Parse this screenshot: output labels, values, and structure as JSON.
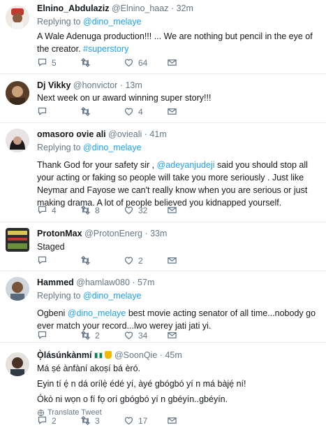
{
  "tweets": [
    {
      "name": "Elnino_Abdulaziz",
      "handle": "@Elnino_haaz",
      "sep": "·",
      "time": "32m",
      "replying_prefix": "Replying to ",
      "replying_to": "@dino_melaye",
      "text_parts": [
        "A Wale Adenuga production!!! ... We are nothing but pencil in the eye of the creator. ",
        "#superstory"
      ],
      "reply_count": "5",
      "retweet_count": "",
      "like_count": "64"
    },
    {
      "name": "Dj Vikky",
      "handle": "@honvictor",
      "sep": "·",
      "time": "13m",
      "text": "Next week on ur award winning super story!!!",
      "reply_count": "",
      "retweet_count": "",
      "like_count": "4"
    },
    {
      "name": "omasoro ovie ali",
      "handle": "@ovieali",
      "sep": "·",
      "time": "41m",
      "replying_prefix": "Replying to ",
      "replying_to": "@dino_melaye",
      "text_parts": [
        "Thank God for your safety sir , ",
        "@adeyanjudeji",
        " said you should stop all your acting or faking so people will take you more seriously . Just like Neymar and Fayose we can't really know when you are serious or just making drama. A lot of people believed you kidnapped yourself."
      ],
      "reply_count": "4",
      "retweet_count": "8",
      "like_count": "32"
    },
    {
      "name": "ProtonMax",
      "handle": "@ProtonEnerg",
      "sep": "·",
      "time": "33m",
      "text": "Staged",
      "reply_count": "",
      "retweet_count": "",
      "like_count": "2"
    },
    {
      "name": "Hammed",
      "handle": "@hamlaw080",
      "sep": "·",
      "time": "57m",
      "replying_prefix": "Replying to ",
      "replying_to": "@dino_melaye",
      "text_parts": [
        "Ogbeni ",
        "@dino_melaye",
        " best movie acting senator of all time...nobody go ever match your record...lwo werey jati jati yi."
      ],
      "reply_count": "",
      "retweet_count": "2",
      "like_count": "34"
    },
    {
      "name": "Ọ̀lásúnkànmí",
      "handle": "@SoonQie",
      "sep": "·",
      "time": "45m",
      "lines": [
        "Má ṣé ànfàní akoṣí bá èró.",
        "Eyin tí ẹ́ n dá orílẹ̀ édé yí, àyé gbógbó yí n má bàjẹ́ ní!",
        "Ókò ni wọn o fí fọ orí gbógbó yí n gbéyín..gbéyín."
      ],
      "translate": "Translate Tweet",
      "reply_count": "2",
      "retweet_count": "3",
      "like_count": "17"
    }
  ],
  "colors": {
    "link": "#1da1f2",
    "muted": "#657786",
    "divider": "#e6ecf0"
  }
}
